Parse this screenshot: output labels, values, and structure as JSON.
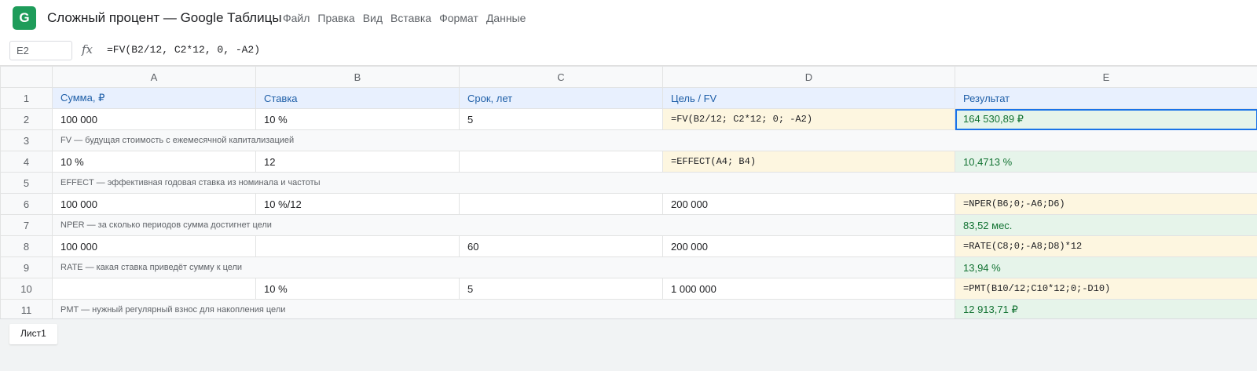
{
  "app": {
    "logo_letter": "G",
    "title": "Сложный процент — Google Таблицы",
    "menu": [
      "Файл",
      "Правка",
      "Вид",
      "Вставка",
      "Формат",
      "Данные"
    ]
  },
  "formula_bar": {
    "cell_ref": "E2",
    "fx_label": "fx",
    "formula": "=FV(B2/12, C2*12, 0, -A2)"
  },
  "columns": [
    "A",
    "B",
    "C",
    "D",
    "E"
  ],
  "rows": [
    {
      "n": "1",
      "a": "Сумма, ₽",
      "b": "Ставка",
      "c": "Срок, лет",
      "d": "Цель / FV",
      "e": "Результат"
    },
    {
      "n": "2",
      "a": "100 000",
      "b": "10 %",
      "c": "5",
      "d": "=FV(B2/12; C2*12; 0; -A2)",
      "e": "164 530,89 ₽"
    },
    {
      "n": "3",
      "note": "FV — будущая стоимость с ежемесячной капитализацией"
    },
    {
      "n": "4",
      "a": "10 %",
      "b": "12",
      "c": "",
      "d": "=EFFECT(A4; B4)",
      "e": "10,4713 %"
    },
    {
      "n": "5",
      "note": "EFFECT — эффективная годовая ставка из номинала и частоты"
    },
    {
      "n": "6",
      "a": "100 000",
      "b": "10 %/12",
      "c": "",
      "d": "200 000",
      "e": "=NPER(B6;0;-A6;D6)"
    },
    {
      "n": "7",
      "note": "NPER — за сколько периодов сумма достигнет цели",
      "e": "83,52 мес."
    },
    {
      "n": "8",
      "a": "100 000",
      "b": "",
      "c": "60",
      "d": "200 000",
      "e": "=RATE(C8;0;-A8;D8)*12"
    },
    {
      "n": "9",
      "note": "RATE — какая ставка приведёт сумму к цели",
      "e": "13,94 %"
    },
    {
      "n": "10",
      "a": "",
      "b": "10 %",
      "c": "5",
      "d": "1 000 000",
      "e": "=PMT(B10/12;C10*12;0;-D10)"
    },
    {
      "n": "11",
      "note": "PMT — нужный регулярный взнос для накопления цели",
      "e": "12 913,71 ₽"
    }
  ],
  "sheets": [
    "Лист1"
  ]
}
